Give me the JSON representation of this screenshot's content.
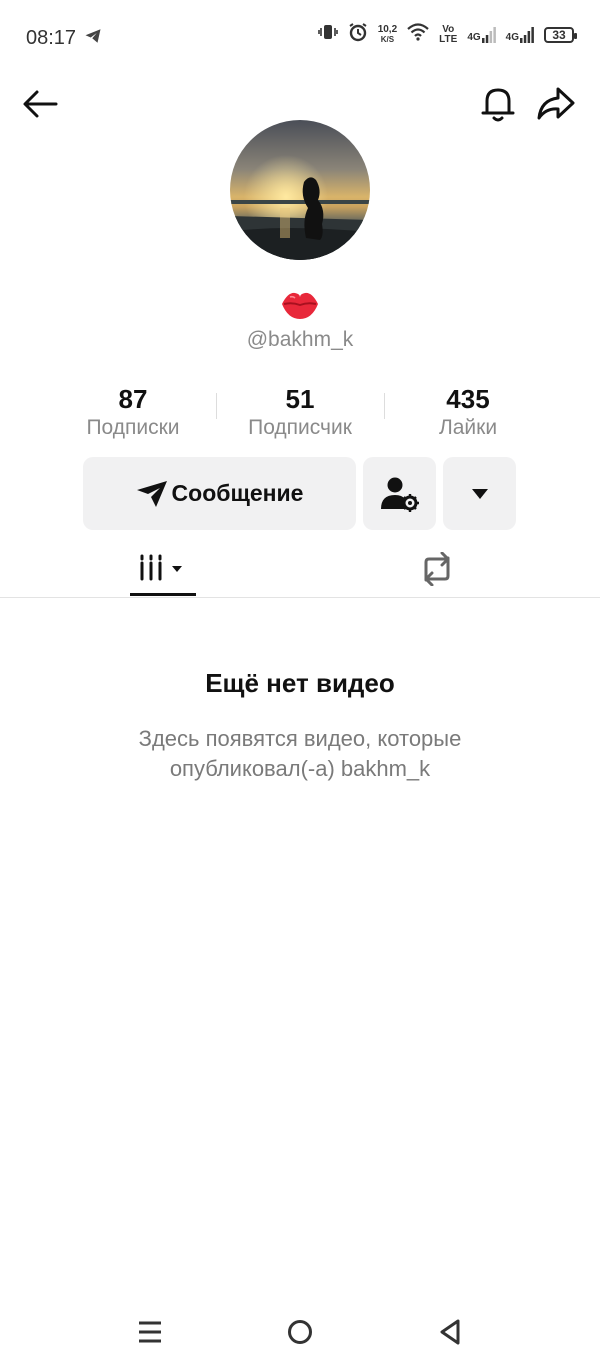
{
  "status_bar": {
    "time": "08:17",
    "speed_value": "10,2",
    "speed_unit": "K/S",
    "volte_top": "Vo",
    "volte_bottom": "LTE",
    "network1": "4G",
    "network2": "4G",
    "battery": "33"
  },
  "header": {
    "back_icon": "arrow-left-icon",
    "bell_icon": "bell-icon",
    "share_icon": "share-icon"
  },
  "profile": {
    "username": "@bakhm_k",
    "emoji_icon": "lips-icon"
  },
  "stats": [
    {
      "value": "87",
      "label": "Подписки"
    },
    {
      "value": "51",
      "label": "Подписчик"
    },
    {
      "value": "435",
      "label": "Лайки"
    }
  ],
  "actions": {
    "message_label": "Сообщение"
  },
  "empty_state": {
    "title": "Ещё нет видео",
    "subtitle_line1": "Здесь появятся видео, которые",
    "subtitle_line2": "опубликовал(-а) bakhm_k"
  },
  "colors": {
    "background": "#ffffff",
    "button_bg": "#f1f1f2",
    "muted_text": "#8a8a8a",
    "lips_red": "#e8283a"
  }
}
